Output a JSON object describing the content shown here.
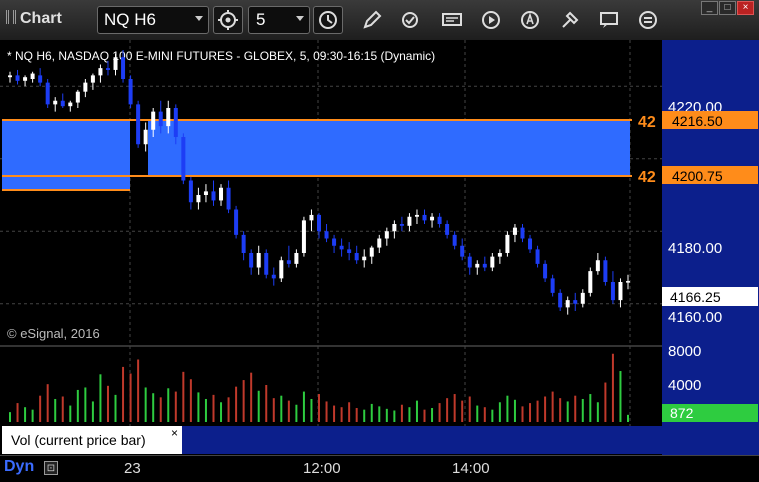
{
  "window": {
    "title": "Chart"
  },
  "toolbar": {
    "symbol": "NQ H6",
    "interval": "5",
    "icons": [
      "gear-icon",
      "clock-icon",
      "pencil-icon",
      "refresh-icon",
      "news-icon",
      "play-icon",
      "alert-icon",
      "tools-icon",
      "chat-icon",
      "menu-icon"
    ]
  },
  "chart": {
    "description": "* NQ H6, NASDAQ 100 E-MINI FUTURES - GLOBEX, 5, 09:30-16:15 (Dynamic)",
    "copyright": "© eSignal, 2016",
    "price_ticks": [
      "4220.00",
      "4180.00",
      "4160.00"
    ],
    "order_lines": [
      {
        "qty": "42",
        "price": "4216.50"
      },
      {
        "qty": "42",
        "price": "4200.75"
      }
    ],
    "last_price": "4166.25",
    "volume_ticks": [
      "8000",
      "4000"
    ],
    "last_volume": "872",
    "study_label": "Vol (current price bar)",
    "study_close": "×",
    "time_labels": [
      "23",
      "12:00",
      "14:00"
    ],
    "footer_mode": "Dyn",
    "colors": {
      "up": "#ffffff",
      "down": "#1d3df5",
      "zone": "#2f6bff",
      "order": "#ff8c1a",
      "vol_up": "#2ecc40",
      "vol_down": "#c0392b"
    }
  },
  "chart_data": {
    "type": "candlestick",
    "price_axis": [
      4150,
      4230
    ],
    "bars": [
      [
        4222.5,
        4224,
        4221,
        4223
      ],
      [
        4223,
        4224.5,
        4220.5,
        4221.5
      ],
      [
        4221.5,
        4223,
        4220,
        4222.5
      ],
      [
        4222,
        4224,
        4221,
        4223.5
      ],
      [
        4223,
        4225,
        4220,
        4221
      ],
      [
        4221,
        4222,
        4214,
        4215
      ],
      [
        4215,
        4217,
        4213,
        4216
      ],
      [
        4216,
        4218,
        4214,
        4214.5
      ],
      [
        4214.5,
        4216,
        4213,
        4215.5
      ],
      [
        4215.5,
        4219,
        4214,
        4218.5
      ],
      [
        4218.5,
        4222,
        4217,
        4221
      ],
      [
        4221,
        4223.5,
        4219,
        4223
      ],
      [
        4223,
        4226,
        4221,
        4225
      ],
      [
        4225,
        4227,
        4223,
        4224.5
      ],
      [
        4224.5,
        4229,
        4223,
        4228
      ],
      [
        4228,
        4230,
        4221,
        4222
      ],
      [
        4222,
        4223,
        4214,
        4215
      ],
      [
        4215,
        4216,
        4203,
        4204
      ],
      [
        4204,
        4210,
        4202,
        4208
      ],
      [
        4208,
        4214,
        4206,
        4213
      ],
      [
        4213,
        4216,
        4207,
        4209
      ],
      [
        4209,
        4216,
        4207,
        4214
      ],
      [
        4214,
        4215,
        4204,
        4206
      ],
      [
        4206,
        4207,
        4193,
        4194
      ],
      [
        4194,
        4195,
        4186,
        4188
      ],
      [
        4188,
        4192,
        4186,
        4190
      ],
      [
        4190,
        4193,
        4188,
        4191
      ],
      [
        4191,
        4194,
        4187,
        4188.5
      ],
      [
        4188.5,
        4193,
        4187,
        4192
      ],
      [
        4192,
        4194,
        4185,
        4186
      ],
      [
        4186,
        4187,
        4178,
        4179
      ],
      [
        4179,
        4180,
        4172,
        4174
      ],
      [
        4174,
        4175,
        4168,
        4170
      ],
      [
        4170,
        4176,
        4168,
        4174
      ],
      [
        4174,
        4175,
        4167,
        4168
      ],
      [
        4168,
        4170,
        4165,
        4167
      ],
      [
        4167,
        4173,
        4166,
        4172
      ],
      [
        4172,
        4176,
        4170,
        4171
      ],
      [
        4171,
        4175,
        4170,
        4174
      ],
      [
        4174,
        4184,
        4173,
        4183
      ],
      [
        4183,
        4186,
        4180,
        4184.5
      ],
      [
        4184.5,
        4185,
        4178,
        4180
      ],
      [
        4180,
        4182,
        4177,
        4178
      ],
      [
        4178,
        4179,
        4174,
        4176
      ],
      [
        4176,
        4178,
        4173,
        4175
      ],
      [
        4175,
        4177,
        4172,
        4174
      ],
      [
        4174,
        4176,
        4171,
        4172
      ],
      [
        4172,
        4175,
        4170,
        4173
      ],
      [
        4173,
        4176,
        4171,
        4175.5
      ],
      [
        4175.5,
        4179,
        4174,
        4178
      ],
      [
        4178,
        4181,
        4176,
        4180
      ],
      [
        4180,
        4183,
        4178,
        4182
      ],
      [
        4182,
        4184,
        4180,
        4181.5
      ],
      [
        4181.5,
        4185,
        4180,
        4184
      ],
      [
        4184,
        4186,
        4182,
        4184.5
      ],
      [
        4184.5,
        4186,
        4182,
        4183
      ],
      [
        4183,
        4185,
        4181,
        4184
      ],
      [
        4184,
        4185,
        4181,
        4182
      ],
      [
        4182,
        4183,
        4178,
        4179
      ],
      [
        4179,
        4180,
        4175,
        4176
      ],
      [
        4176,
        4178,
        4172,
        4173
      ],
      [
        4173,
        4174,
        4168,
        4170
      ],
      [
        4170,
        4172,
        4168,
        4171
      ],
      [
        4171,
        4173,
        4169,
        4170
      ],
      [
        4170,
        4174,
        4169,
        4173
      ],
      [
        4173,
        4175,
        4171,
        4174
      ],
      [
        4174,
        4180,
        4173,
        4179
      ],
      [
        4179,
        4182,
        4177,
        4181
      ],
      [
        4181,
        4182,
        4177,
        4178
      ],
      [
        4178,
        4179,
        4174,
        4175
      ],
      [
        4175,
        4176,
        4170,
        4171
      ],
      [
        4171,
        4172,
        4166,
        4167
      ],
      [
        4167,
        4168,
        4162,
        4163
      ],
      [
        4163,
        4164,
        4158,
        4159
      ],
      [
        4159,
        4162,
        4157,
        4161
      ],
      [
        4161,
        4163,
        4158,
        4160
      ],
      [
        4160,
        4164,
        4159,
        4163
      ],
      [
        4163,
        4170,
        4162,
        4169
      ],
      [
        4169,
        4174,
        4168,
        4172
      ],
      [
        4172,
        4173,
        4165,
        4166
      ],
      [
        4166,
        4169,
        4160,
        4161
      ],
      [
        4161,
        4167,
        4159,
        4166
      ],
      [
        4166,
        4168,
        4164,
        4166.25
      ]
    ],
    "volume_axis": [
      0,
      9000
    ],
    "volume": [
      1200,
      2300,
      1800,
      1500,
      3200,
      4600,
      2800,
      3100,
      2000,
      3900,
      4200,
      2500,
      5800,
      4400,
      3300,
      6700,
      5900,
      7600,
      4200,
      3500,
      3000,
      4100,
      3700,
      6100,
      5200,
      3600,
      2800,
      3300,
      2400,
      3000,
      4300,
      5100,
      6000,
      3800,
      4500,
      2900,
      3200,
      2600,
      2100,
      3700,
      2800,
      3400,
      2500,
      2000,
      1800,
      2400,
      1700,
      1500,
      2200,
      1900,
      1600,
      1400,
      2100,
      1800,
      2600,
      1500,
      1700,
      2300,
      2900,
      3400,
      2600,
      3100,
      2000,
      1800,
      1500,
      2400,
      3200,
      2700,
      1900,
      2300,
      2600,
      3100,
      3700,
      2900,
      2500,
      3200,
      2800,
      3400,
      2400,
      4800,
      8300,
      6200,
      872
    ],
    "time_labels": [
      "23",
      "12:00",
      "14:00"
    ]
  }
}
